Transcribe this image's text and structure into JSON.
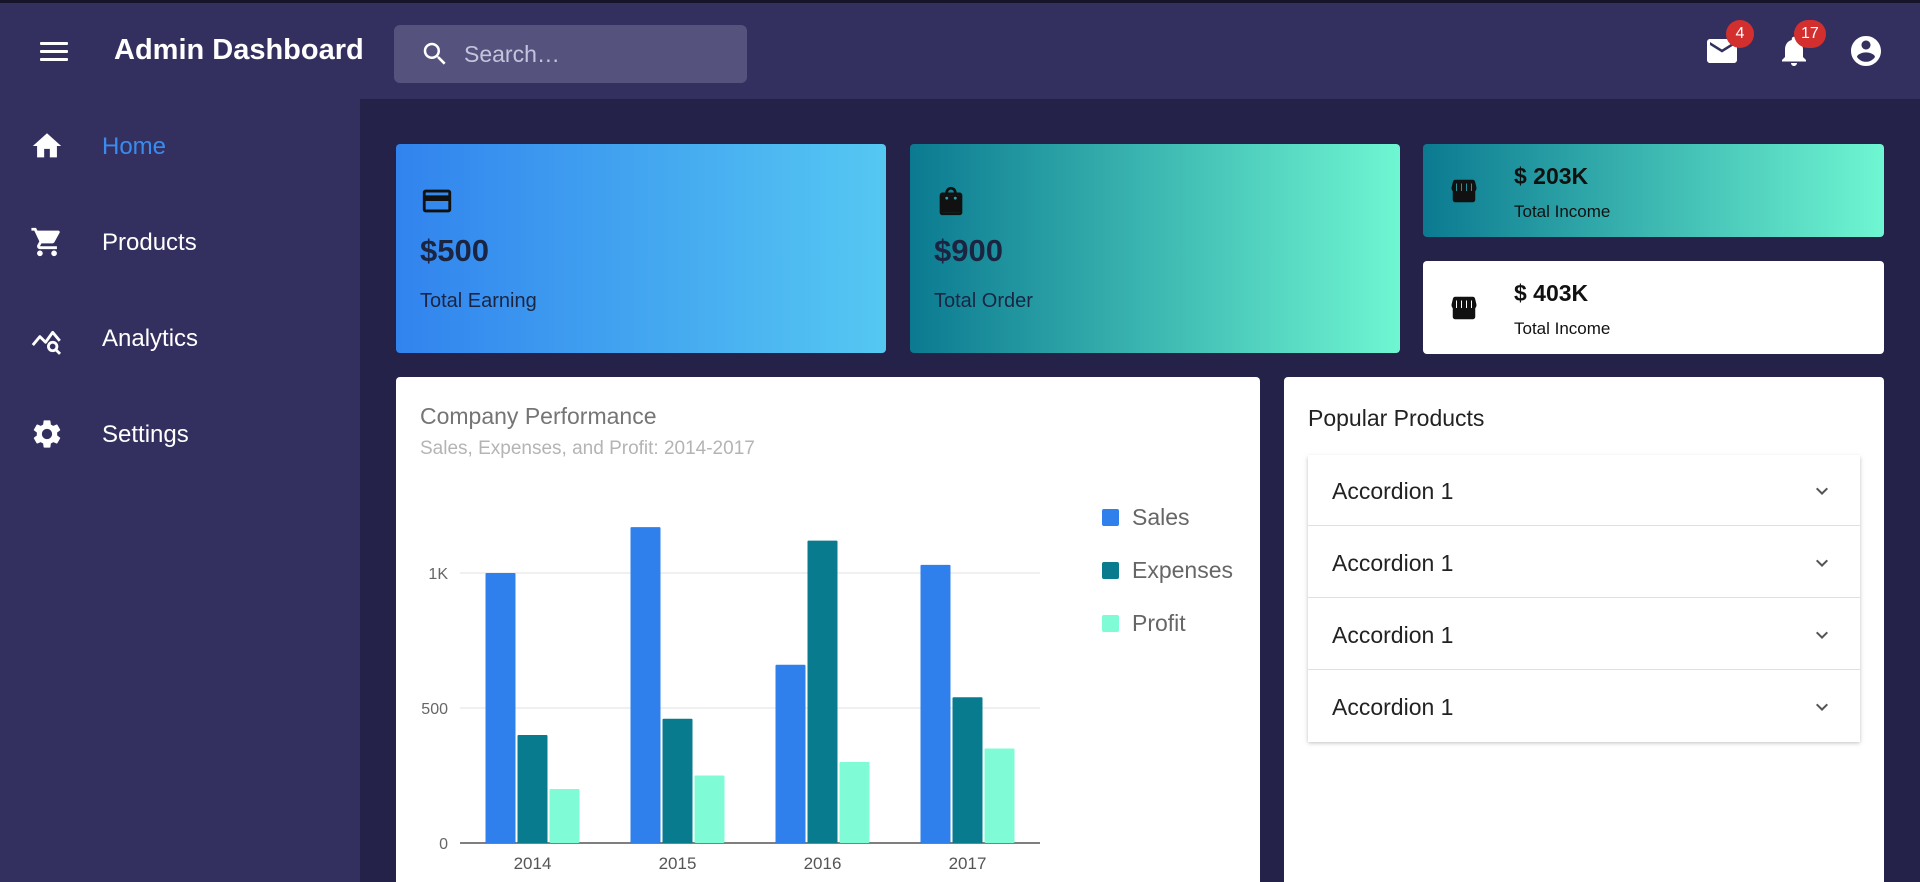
{
  "header": {
    "title": "Admin Dashboard",
    "search_placeholder": "Search…",
    "mail_badge": "4",
    "notification_badge": "17"
  },
  "sidebar": {
    "items": [
      {
        "label": "Home",
        "icon": "home-icon",
        "active": true
      },
      {
        "label": "Products",
        "icon": "cart-icon"
      },
      {
        "label": "Analytics",
        "icon": "analytics-icon"
      },
      {
        "label": "Settings",
        "icon": "gear-icon"
      }
    ]
  },
  "cards": {
    "earning": {
      "amount": "$500",
      "caption": "Total Earning",
      "icon": "credit-card-icon"
    },
    "order": {
      "amount": "$900",
      "caption": "Total Order",
      "icon": "shopping-bag-icon"
    },
    "income_1": {
      "amount": "$ 203K",
      "caption": "Total Income",
      "icon": "store-icon"
    },
    "income_2": {
      "amount": "$ 403K",
      "caption": "Total Income",
      "icon": "store-icon"
    }
  },
  "performance": {
    "title": "Company Performance",
    "subtitle": "Sales, Expenses, and Profit: 2014-2017"
  },
  "chart_data": {
    "type": "bar",
    "categories": [
      "2014",
      "2015",
      "2016",
      "2017"
    ],
    "series": [
      {
        "name": "Sales",
        "values": [
          1000,
          1170,
          660,
          1030
        ],
        "color": "#2f80ed"
      },
      {
        "name": "Expenses",
        "values": [
          400,
          460,
          1120,
          540
        ],
        "color": "#087b8e"
      },
      {
        "name": "Profit",
        "values": [
          200,
          250,
          300,
          350
        ],
        "color": "#7ffcd6"
      }
    ],
    "y_ticks": [
      "0",
      "500",
      "1K"
    ],
    "y_tick_values": [
      0,
      500,
      1000
    ],
    "ylim": [
      0,
      1200
    ],
    "grid": true,
    "legend": "right"
  },
  "popular": {
    "title": "Popular Products",
    "items": [
      "Accordion 1",
      "Accordion 1",
      "Accordion 1",
      "Accordion 1"
    ]
  }
}
